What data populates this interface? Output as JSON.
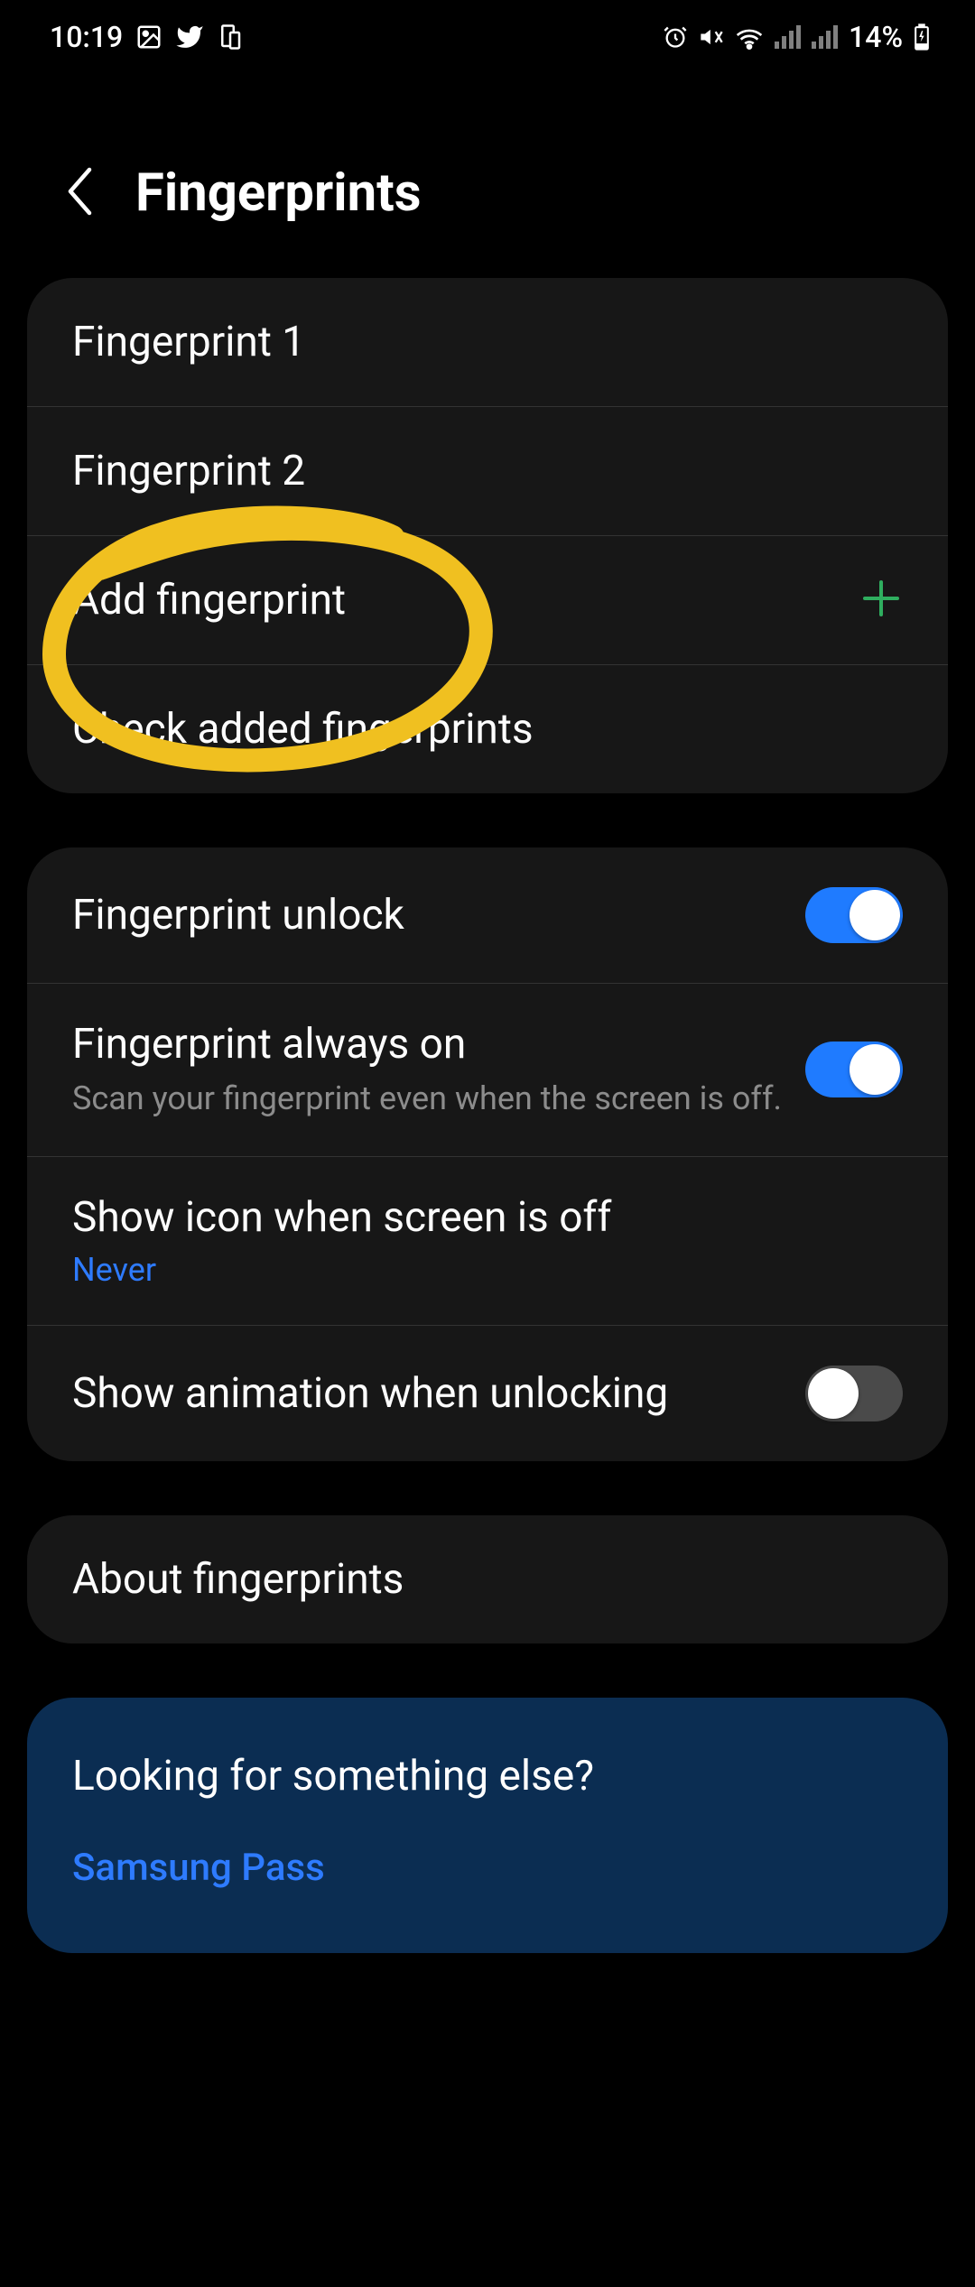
{
  "status_bar": {
    "time": "10:19",
    "battery_text": "14%"
  },
  "header": {
    "title": "Fingerprints"
  },
  "card1": {
    "items": [
      {
        "label": "Fingerprint 1"
      },
      {
        "label": "Fingerprint 2"
      },
      {
        "label": "Add fingerprint"
      },
      {
        "label": "Check added fingerprints"
      }
    ]
  },
  "card2": {
    "unlock": {
      "title": "Fingerprint unlock"
    },
    "always_on": {
      "title": "Fingerprint always on",
      "subtitle": "Scan your fingerprint even when the screen is off."
    },
    "show_icon": {
      "title": "Show icon when screen is off",
      "value": "Never"
    },
    "animation": {
      "title": "Show animation when unlocking"
    }
  },
  "card3": {
    "about": "About fingerprints"
  },
  "card_blue": {
    "title": "Looking for something else?",
    "link": "Samsung Pass"
  }
}
